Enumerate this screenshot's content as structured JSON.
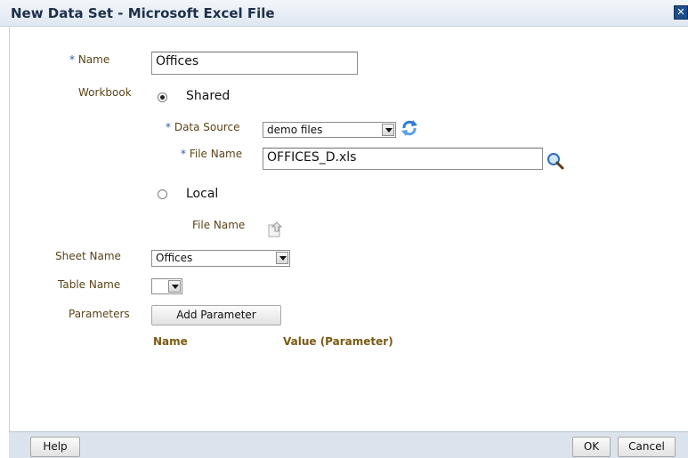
{
  "dialog": {
    "title": "New Data Set - Microsoft Excel File",
    "close_glyph": "✕"
  },
  "form": {
    "name": {
      "label": "Name",
      "required_mark": "*",
      "value": "Offices"
    },
    "workbook": {
      "label": "Workbook",
      "shared_label": "Shared",
      "shared_selected": true,
      "local_label": "Local",
      "local_selected": false
    },
    "data_source": {
      "label": "Data Source",
      "required_mark": "*",
      "value": "demo files",
      "refresh_icon": "refresh-icon"
    },
    "shared_file_name": {
      "label": "File Name",
      "required_mark": "*",
      "value": "OFFICES_D.xls",
      "search_icon": "search-icon"
    },
    "local_file_name": {
      "label": "File Name",
      "upload_icon": "upload-icon"
    },
    "sheet_name": {
      "label": "Sheet Name",
      "value": "Offices"
    },
    "table_name": {
      "label": "Table Name",
      "value": ""
    },
    "parameters": {
      "label": "Parameters",
      "add_button": "Add Parameter",
      "columns": [
        "Name",
        "Value (Parameter)"
      ]
    }
  },
  "footer": {
    "help": "Help",
    "ok": "OK",
    "cancel": "Cancel"
  },
  "colors": {
    "label": "#5a4418",
    "required": "#2c5ba8",
    "column_header": "#7a5a14",
    "footer_bg": "#dbe3ed"
  }
}
